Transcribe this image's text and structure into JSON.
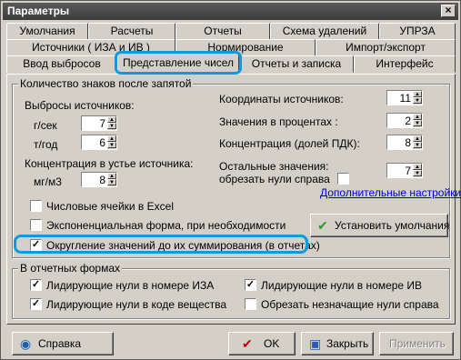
{
  "window": {
    "title": "Параметры",
    "close": "×"
  },
  "tabs": {
    "row1": [
      "Умолчания",
      "Расчеты",
      "Отчеты",
      "Схема удалений",
      "УПРЗА"
    ],
    "row2": [
      "Источники ( ИЗА и ИВ )",
      "Нормирование",
      "Импорт/экспорт"
    ],
    "row3": [
      "Ввод выбросов",
      "Представление чисел",
      "Отчеты и записка",
      "Интерфейс"
    ],
    "active": "Представление чисел"
  },
  "decimals": {
    "title": "Количество знаков после запятой",
    "emissions_label": "Выбросы источников:",
    "gs_label": "г/сек",
    "gs_value": "7",
    "ty_label": "т/год",
    "ty_value": "6",
    "mouth_label": "Концентрация в устье источника:",
    "mgm3_label": "мг/м3",
    "mgm3_value": "8",
    "coords_label": "Координаты источников:",
    "coords_value": "11",
    "percent_label": "Значения  в процентах :",
    "percent_value": "2",
    "pdk_label": "Концентрация (долей ПДК):",
    "pdk_value": "8",
    "other_label1": "Остальные значения:",
    "other_label2": "обрезать нули справа",
    "other_value": "7",
    "more_settings": "Дополнительные настройки"
  },
  "checks": {
    "excel": {
      "label": "Числовые ячейки в Excel",
      "checked": false
    },
    "exp": {
      "label": "Экспоненциальная форма, при необходимости",
      "checked": false
    },
    "round": {
      "label": "Округление значений до их суммирования (в отчетах)",
      "checked": true
    }
  },
  "set_defaults": "Установить умолчания",
  "report_forms": {
    "title": "В отчетных формах",
    "iza": {
      "label": "Лидирующие нули в номере ИЗА",
      "checked": true
    },
    "iv": {
      "label": "Лидирующие нули в номере ИВ",
      "checked": true
    },
    "subst": {
      "label": "Лидирующие нули в коде вещества",
      "checked": true
    },
    "trim": {
      "label": "Обрезать незначащие нули справа",
      "checked": false
    }
  },
  "buttons": {
    "help": "Справка",
    "ok": "OK",
    "close": "Закрыть",
    "apply": "Применить"
  },
  "colors": {
    "highlight": "#0f9ae0",
    "check_green": "#2a9a2a",
    "close_red": "#c00000"
  }
}
